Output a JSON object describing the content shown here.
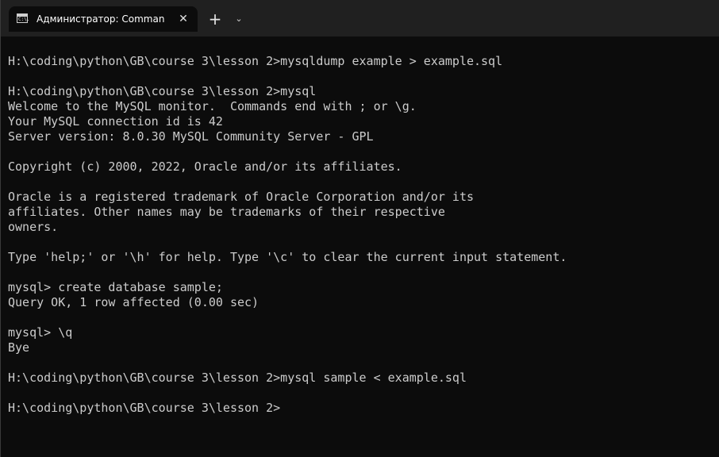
{
  "tab": {
    "title": "Администратор: Command Prompt",
    "icon": "console-icon",
    "icon_text": "C:\\.",
    "close": "✕"
  },
  "titlebar": {
    "new_tab": "+",
    "dropdown": "⌄"
  },
  "terminal": {
    "lines": [
      "H:\\coding\\python\\GB\\course 3\\lesson 2>mysqldump example > example.sql",
      "",
      "H:\\coding\\python\\GB\\course 3\\lesson 2>mysql",
      "Welcome to the MySQL monitor.  Commands end with ; or \\g.",
      "Your MySQL connection id is 42",
      "Server version: 8.0.30 MySQL Community Server - GPL",
      "",
      "Copyright (c) 2000, 2022, Oracle and/or its affiliates.",
      "",
      "Oracle is a registered trademark of Oracle Corporation and/or its",
      "affiliates. Other names may be trademarks of their respective",
      "owners.",
      "",
      "Type 'help;' or '\\h' for help. Type '\\c' to clear the current input statement.",
      "",
      "mysql> create database sample;",
      "Query OK, 1 row affected (0.00 sec)",
      "",
      "mysql> \\q",
      "Bye",
      "",
      "H:\\coding\\python\\GB\\course 3\\lesson 2>mysql sample < example.sql",
      "",
      "H:\\coding\\python\\GB\\course 3\\lesson 2>"
    ]
  },
  "colors": {
    "background": "#0c0c0c",
    "titlebar": "#202020",
    "text": "#cccccc"
  }
}
